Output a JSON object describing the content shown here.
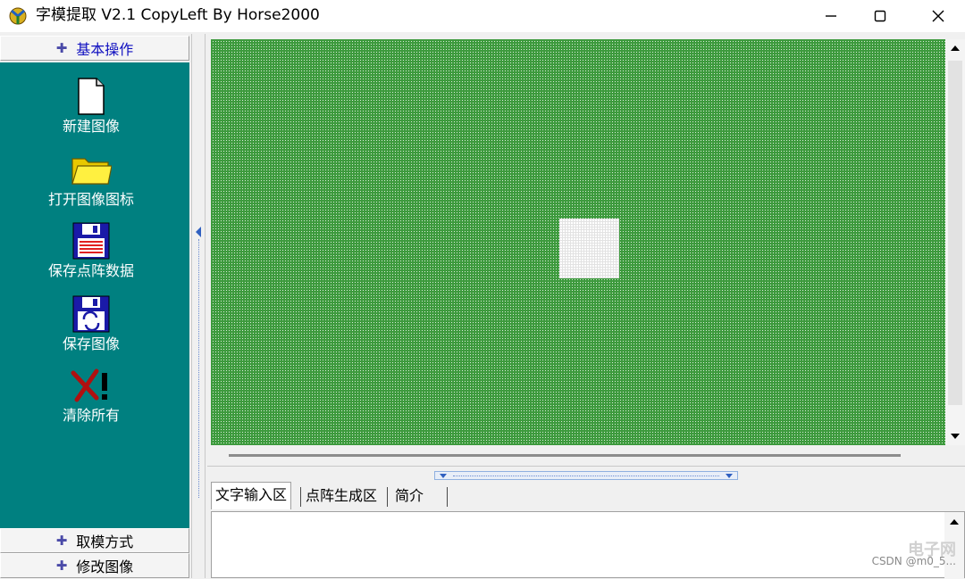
{
  "window": {
    "title": "字模提取 V2.1  CopyLeft By Horse2000",
    "app_icon": "app-logo-icon",
    "controls": {
      "minimize": "minimize-icon",
      "maximize": "maximize-icon",
      "close": "close-icon"
    }
  },
  "sidebar": {
    "groups": [
      {
        "label": "基本操作",
        "icon": "plus-icon",
        "active": true
      },
      {
        "label": "取模方式",
        "icon": "plus-icon",
        "active": false
      },
      {
        "label": "修改图像",
        "icon": "plus-icon",
        "active": false
      }
    ],
    "tools": [
      {
        "label": "新建图像",
        "icon": "new-file-icon"
      },
      {
        "label": "打开图像图标",
        "icon": "folder-icon"
      },
      {
        "label": "保存点阵数据",
        "icon": "save-data-icon"
      },
      {
        "label": "保存图像",
        "icon": "save-image-icon"
      },
      {
        "label": "清除所有",
        "icon": "clear-all-icon"
      }
    ],
    "panel_color": "#008080"
  },
  "canvas": {
    "grid_color": "#3d9a3d",
    "block_color": "#ffffff"
  },
  "tabs": [
    {
      "label": "文字输入区",
      "selected": true
    },
    {
      "label": "点阵生成区",
      "selected": false
    },
    {
      "label": "简介",
      "selected": false
    }
  ],
  "watermark": {
    "brand": "电子网",
    "credit": "CSDN @m0_5..."
  }
}
